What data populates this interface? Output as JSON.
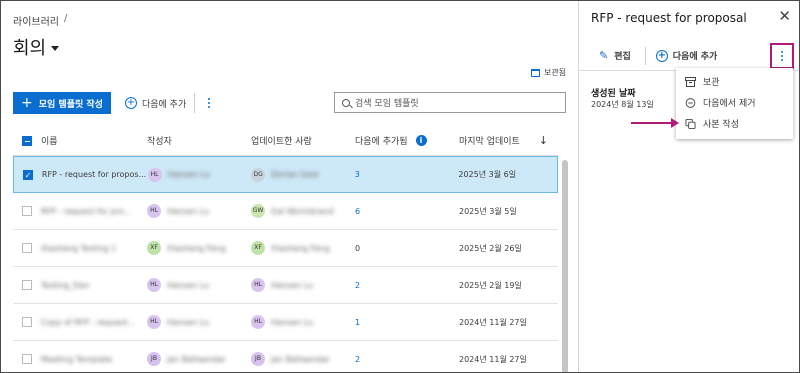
{
  "breadcrumb": {
    "root": "라이브러리",
    "separator": "/"
  },
  "page": {
    "title": "회의"
  },
  "archive_link": {
    "label": "보관됨"
  },
  "toolbar": {
    "create_template": "모임 템플릿 작성",
    "add_to": "다음에 추가",
    "search_placeholder": "검색 모임 템플릿"
  },
  "table": {
    "headers": {
      "name": "이름",
      "author": "작성자",
      "updater": "업데이트한 사람",
      "added_to": "다음에 추가됨",
      "last_updated": "마지막 업데이트"
    },
    "rows": [
      {
        "name": "RFP - request for propos...",
        "author_initials": "HL",
        "author": "Hansen Lu",
        "updater_initials": "DG",
        "updater": "Dorian Gaia",
        "added": "3",
        "date": "2025년 3월 6일",
        "selected": true
      },
      {
        "name": "RFP - request for pro...",
        "author_initials": "HL",
        "author": "Hansen Lu",
        "updater_initials": "GW",
        "updater": "Gal Wormbrand",
        "added": "6",
        "date": "2025년 3월 5일",
        "selected": false
      },
      {
        "name": "Xiaoliang Testing 1",
        "author_initials": "XF",
        "author": "Xiaoliang Feng",
        "updater_initials": "XF",
        "updater": "Xiaoliang Feng",
        "added": "0",
        "date": "2025년 2월 26일",
        "selected": false
      },
      {
        "name": "Testing_Dan",
        "author_initials": "HL",
        "author": "Hansen Lu",
        "updater_initials": "HL",
        "updater": "Hansen Lu",
        "added": "2",
        "date": "2025년 2월 19일",
        "selected": false
      },
      {
        "name": "Copy of RFP - request...",
        "author_initials": "HL",
        "author": "Hansen Lu",
        "updater_initials": "HL",
        "updater": "Hansen Lu",
        "added": "1",
        "date": "2024년 11월 27일",
        "selected": false
      },
      {
        "name": "Meeting Template",
        "author_initials": "JB",
        "author": "Jan Betlaender",
        "updater_initials": "JB",
        "updater": "Jan Betlaender",
        "added": "2",
        "date": "2024년 11월 27일",
        "selected": false
      }
    ]
  },
  "panel": {
    "title": "RFP - request for proposal",
    "close": "✕",
    "edit": "편집",
    "add_to": "다음에 추가",
    "created_label": "생성된 날짜",
    "created_value": "2024년 8월 13일",
    "menu": {
      "archive": "보관",
      "remove_from": "다음에서 제거",
      "duplicate": "사본 작성"
    }
  },
  "colors": {
    "accent": "#0a6ed1",
    "highlight": "#b01a7a",
    "selected_row": "#cde8f6",
    "avatar_HL": "#d9c4ef",
    "avatar_DG": "#c9d3de",
    "avatar_GW": "#c8e6b0",
    "avatar_XF": "#bfe3a6",
    "avatar_JB": "#d7c1ef"
  }
}
